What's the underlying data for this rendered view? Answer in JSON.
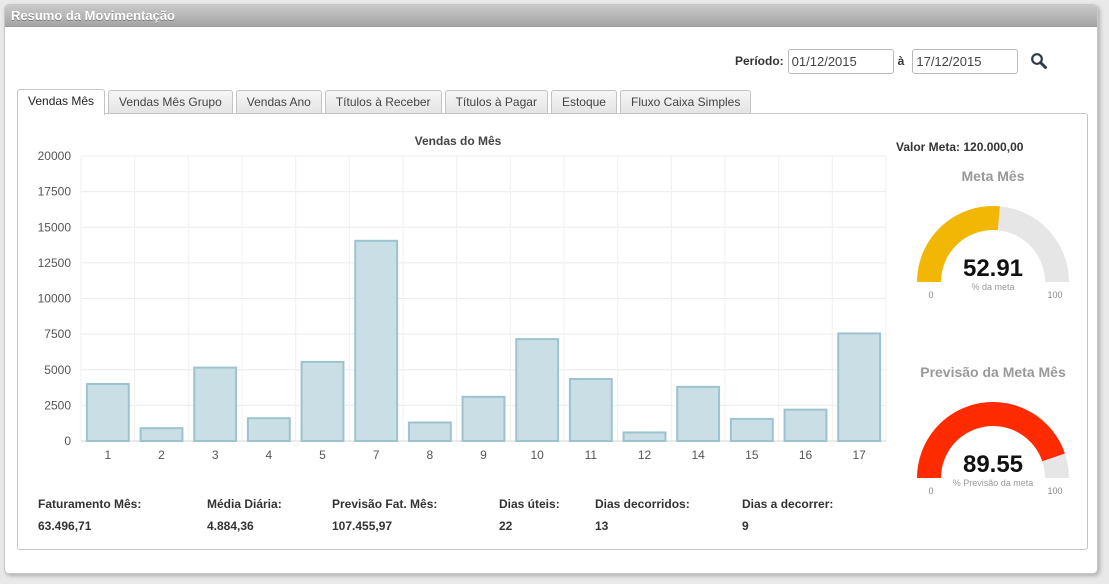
{
  "window": {
    "title": "Resumo da Movimentação"
  },
  "period": {
    "label": "Período:",
    "start": "01/12/2015",
    "separator": "à",
    "end": "17/12/2015"
  },
  "tabs": [
    {
      "label": "Vendas Mês",
      "active": true
    },
    {
      "label": "Vendas Mês Grupo",
      "active": false
    },
    {
      "label": "Vendas Ano",
      "active": false
    },
    {
      "label": "Títulos à Receber",
      "active": false
    },
    {
      "label": "Títulos à Pagar",
      "active": false
    },
    {
      "label": "Estoque",
      "active": false
    },
    {
      "label": "Fluxo Caixa Simples",
      "active": false
    }
  ],
  "meta": {
    "label": "Valor Meta: 120.000,00"
  },
  "chart_data": {
    "type": "bar",
    "title": "Vendas do Mês",
    "categories": [
      "1",
      "2",
      "3",
      "4",
      "5",
      "7",
      "8",
      "9",
      "10",
      "11",
      "12",
      "14",
      "15",
      "16",
      "17"
    ],
    "values": [
      4000,
      900,
      5150,
      1600,
      5550,
      14050,
      1300,
      3100,
      7150,
      4350,
      600,
      3800,
      1550,
      2200,
      7550
    ],
    "ylim": [
      0,
      20000
    ],
    "yticks": [
      0,
      2500,
      5000,
      7500,
      10000,
      12500,
      15000,
      17500,
      20000
    ],
    "grid": true,
    "bar_color": "#c9dee5",
    "bar_border_color": "#9cc3cf"
  },
  "gauges": [
    {
      "title": "Meta Mês",
      "value": 52.91,
      "value_text": "52.91",
      "sublabel": "% da meta",
      "min": "0",
      "max": "100",
      "color": "#f2b705"
    },
    {
      "title": "Previsão da Meta Mês",
      "value": 89.55,
      "value_text": "89.55",
      "sublabel": "% Previsão da meta",
      "min": "0",
      "max": "100",
      "color": "#ff2b00"
    }
  ],
  "stats": [
    {
      "label": "Faturamento Mês:",
      "value": "63.496,71"
    },
    {
      "label": "Média Diária:",
      "value": "4.884,36"
    },
    {
      "label": "Previsão Fat. Mês:",
      "value": "107.455,97"
    },
    {
      "label": "Dias úteis:",
      "value": "22"
    },
    {
      "label": "Dias decorridos:",
      "value": "13"
    },
    {
      "label": "Dias a decorrer:",
      "value": "9"
    }
  ]
}
